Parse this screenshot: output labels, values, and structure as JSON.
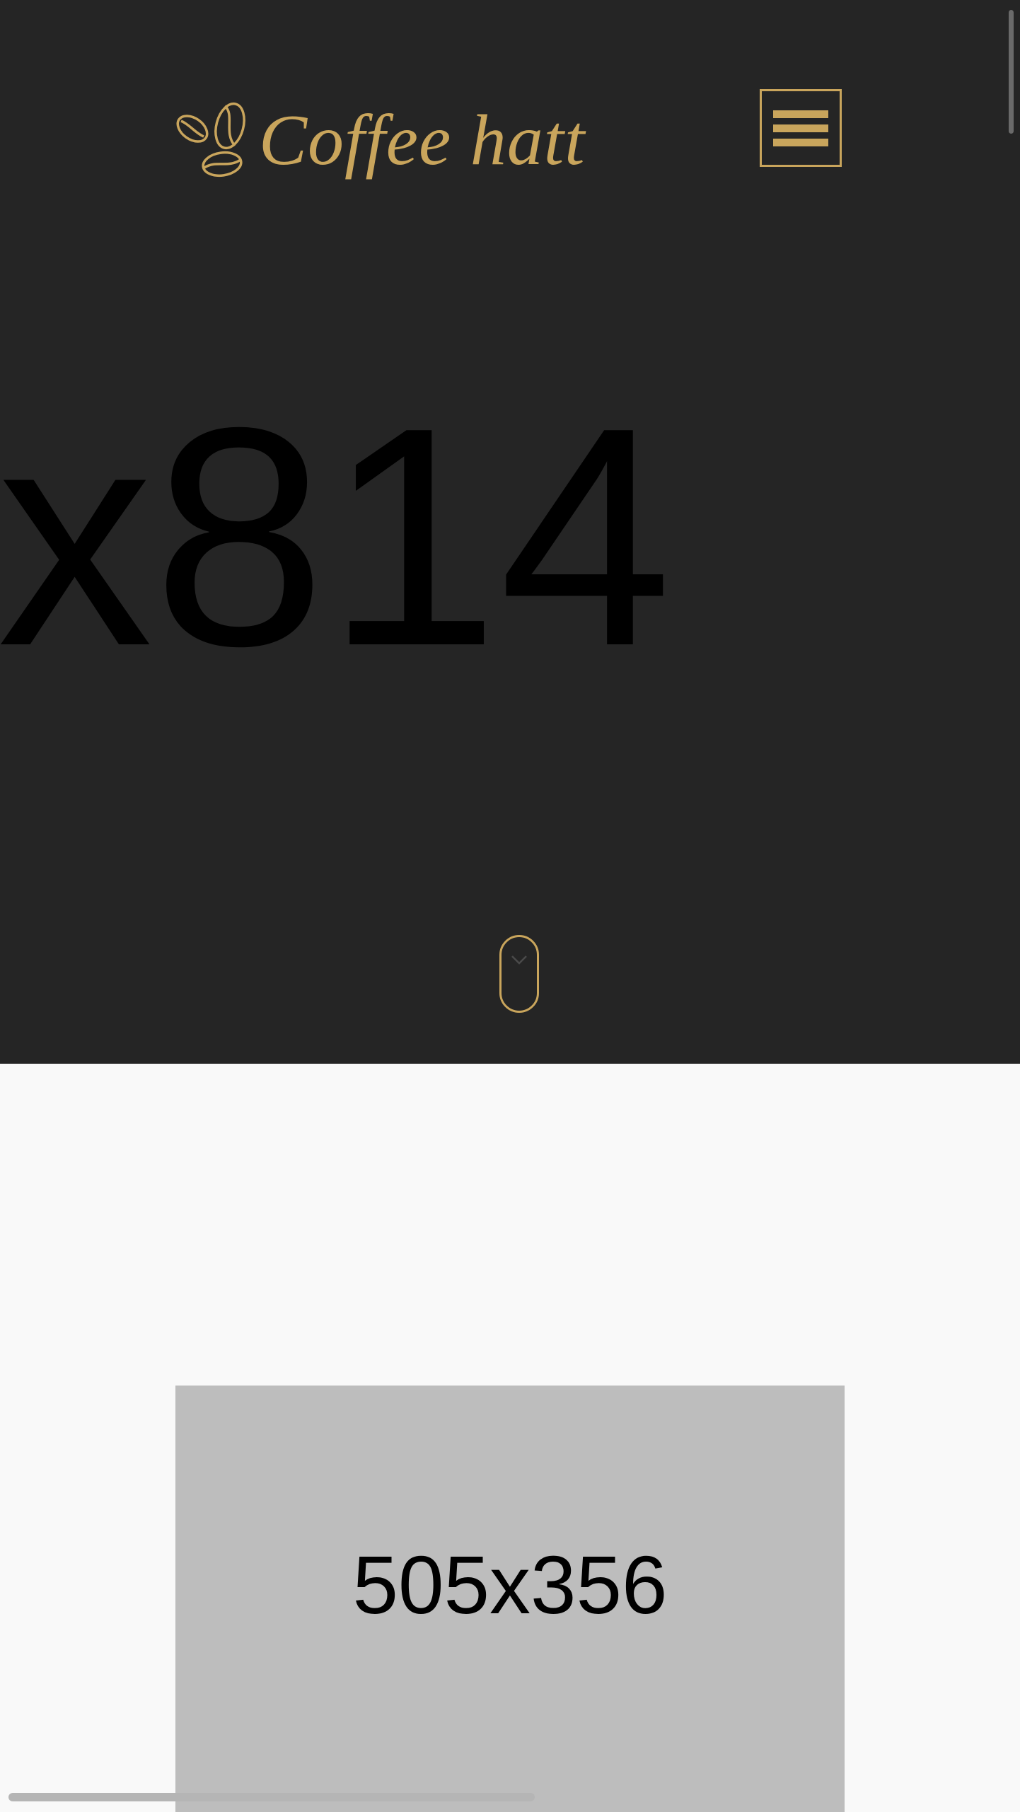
{
  "header": {
    "brand_name": "Coffee hatt",
    "logo_icon": "coffee-beans-icon",
    "menu_icon": "hamburger-menu-icon"
  },
  "hero": {
    "placeholder_text": "x814",
    "scroll_icon": "chevron-down-icon"
  },
  "content": {
    "image_placeholder_text": "505x356"
  },
  "colors": {
    "accent_gold": "#c9a55c",
    "hero_background": "#252525",
    "page_background": "#f9f9f9",
    "placeholder_gray": "#bdbdbd"
  }
}
